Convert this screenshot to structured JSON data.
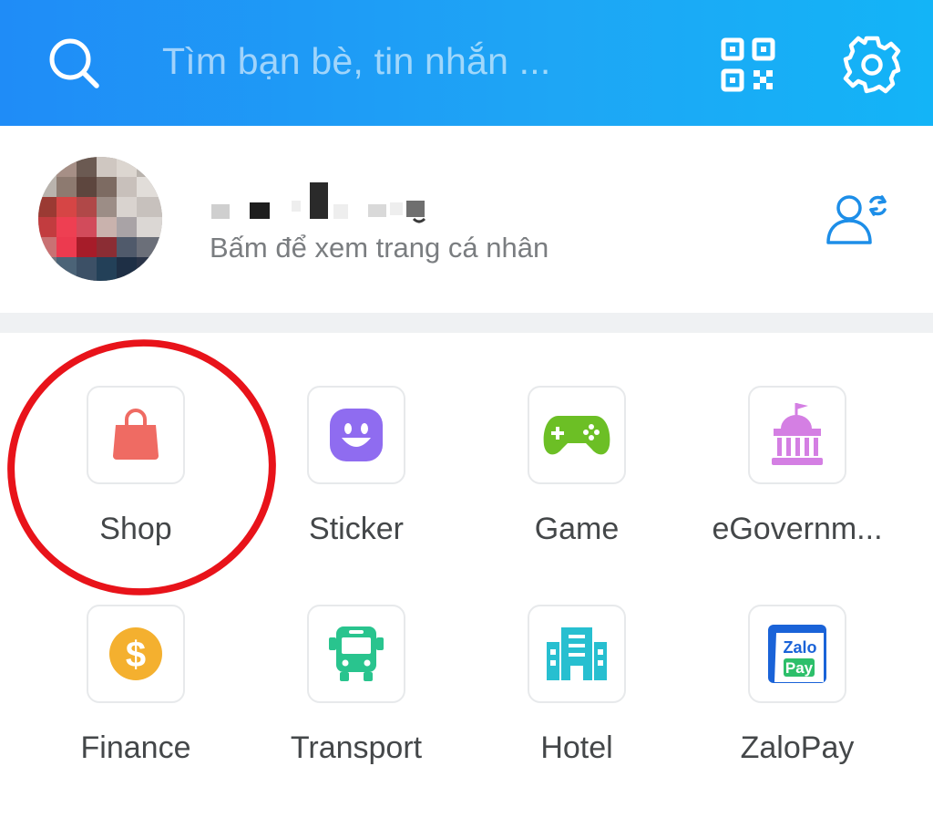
{
  "header": {
    "search_placeholder": "Tìm bạn bè, tin nhắn ...",
    "icons": [
      "search-icon",
      "qr-code-icon",
      "gear-icon"
    ],
    "bg_gradient": [
      "#1f8cf7",
      "#13b4f7"
    ]
  },
  "profile": {
    "subtitle": "Bấm để xem trang cá nhân",
    "switch_account_icon": "user-switch-icon"
  },
  "apps": [
    {
      "label": "Shop",
      "icon": "shopping-bag-icon",
      "color": "#ef6b63",
      "highlighted": true
    },
    {
      "label": "Sticker",
      "icon": "smiley-icon",
      "color": "#8f6cf0"
    },
    {
      "label": "Game",
      "icon": "gamepad-icon",
      "color": "#6cbf25"
    },
    {
      "label": "eGovernm...",
      "icon": "government-building-icon",
      "color": "#d47fe3"
    },
    {
      "label": "Finance",
      "icon": "dollar-coin-icon",
      "color": "#f4b02f"
    },
    {
      "label": "Transport",
      "icon": "bus-icon",
      "color": "#29c48e"
    },
    {
      "label": "Hotel",
      "icon": "hotel-icon",
      "color": "#27bfd0"
    },
    {
      "label": "ZaloPay",
      "icon": "zalopay-logo-icon",
      "color": "#1a63d8"
    }
  ],
  "annotation": {
    "highlight_color": "#e8131a"
  }
}
